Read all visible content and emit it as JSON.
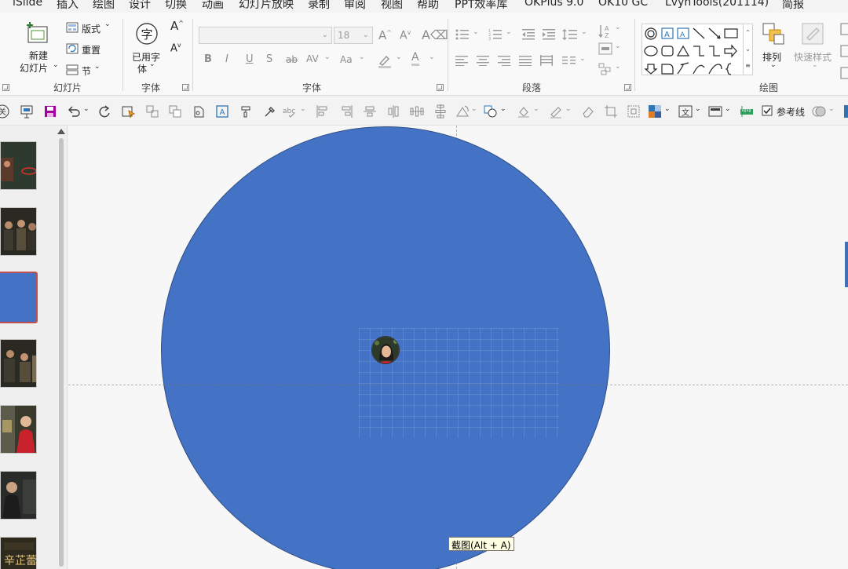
{
  "menu": {
    "items": [
      "iSlide",
      "插入",
      "绘图",
      "设计",
      "切换",
      "动画",
      "幻灯片放映",
      "录制",
      "审阅",
      "视图",
      "帮助",
      "PPT效率库",
      "OKPlus 9.0",
      "OK10 GC",
      "LvyhTools(201114)",
      "简报"
    ]
  },
  "ribbon": {
    "slides_group": {
      "label": "幻灯片",
      "new_slide_line1": "新建",
      "new_slide_line2": "幻灯片",
      "layout": "版式",
      "reset": "重置",
      "section": "节"
    },
    "used_fonts_group": {
      "label": "字体",
      "button_line1": "已用字",
      "button_line2": "体"
    },
    "font_group": {
      "label": "字体",
      "font_name": "",
      "font_size": "18",
      "bold": "B",
      "italic": "I",
      "underline": "U",
      "shadow": "S",
      "strikethrough": "ab",
      "char_spacing": "AV",
      "change_case": "Aa",
      "font_color": "A"
    },
    "paragraph_group": {
      "label": "段落"
    },
    "drawing_group": {
      "label": "绘图",
      "arrange": "排列",
      "quick_styles": "快速样式"
    }
  },
  "qat": {
    "guides_label": "参考线",
    "guides_checked": true
  },
  "thumbnails": {
    "count": 7,
    "selected_index": 2
  },
  "slide": {
    "circle_color": "#4472C4",
    "tooltip": "截图(Alt + A)"
  },
  "colors": {
    "accent_red": "#C0504D",
    "shape_blue": "#4472C4",
    "icon_blue": "#2E75B6",
    "save_purple": "#A4009E"
  }
}
